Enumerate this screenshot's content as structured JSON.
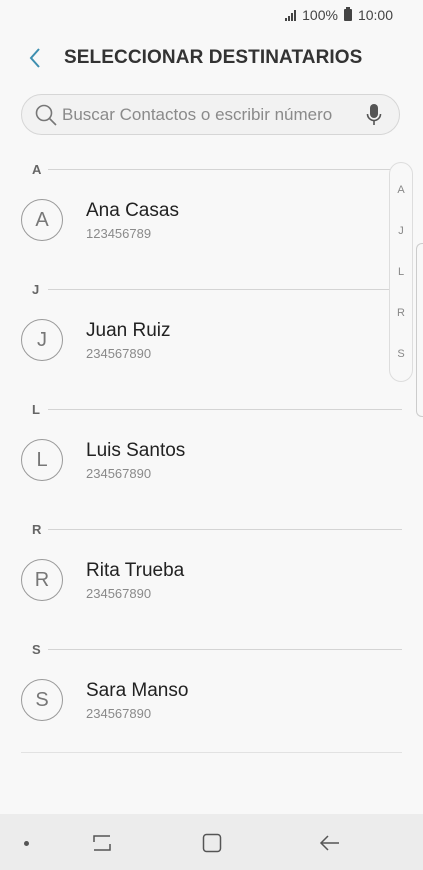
{
  "status_bar": {
    "battery": "100%",
    "time": "10:00"
  },
  "header": {
    "title": "SELECCIONAR DESTINATARIOS"
  },
  "search": {
    "placeholder": "Buscar Contactos o escribir número"
  },
  "sections": [
    {
      "letter": "A",
      "contact": {
        "initial": "A",
        "name": "Ana Casas",
        "phone": "123456789"
      }
    },
    {
      "letter": "J",
      "contact": {
        "initial": "J",
        "name": "Juan Ruiz",
        "phone": "234567890"
      }
    },
    {
      "letter": "L",
      "contact": {
        "initial": "L",
        "name": "Luis Santos",
        "phone": "234567890"
      }
    },
    {
      "letter": "R",
      "contact": {
        "initial": "R",
        "name": "Rita Trueba",
        "phone": "234567890"
      }
    },
    {
      "letter": "S",
      "contact": {
        "initial": "S",
        "name": "Sara Manso",
        "phone": "234567890"
      }
    }
  ],
  "index_letters": [
    "A",
    "J",
    "L",
    "R",
    "S"
  ],
  "colors": {
    "accent": "#3e8fb0",
    "background": "#f8f8f8",
    "nav_bar": "#ececec"
  }
}
